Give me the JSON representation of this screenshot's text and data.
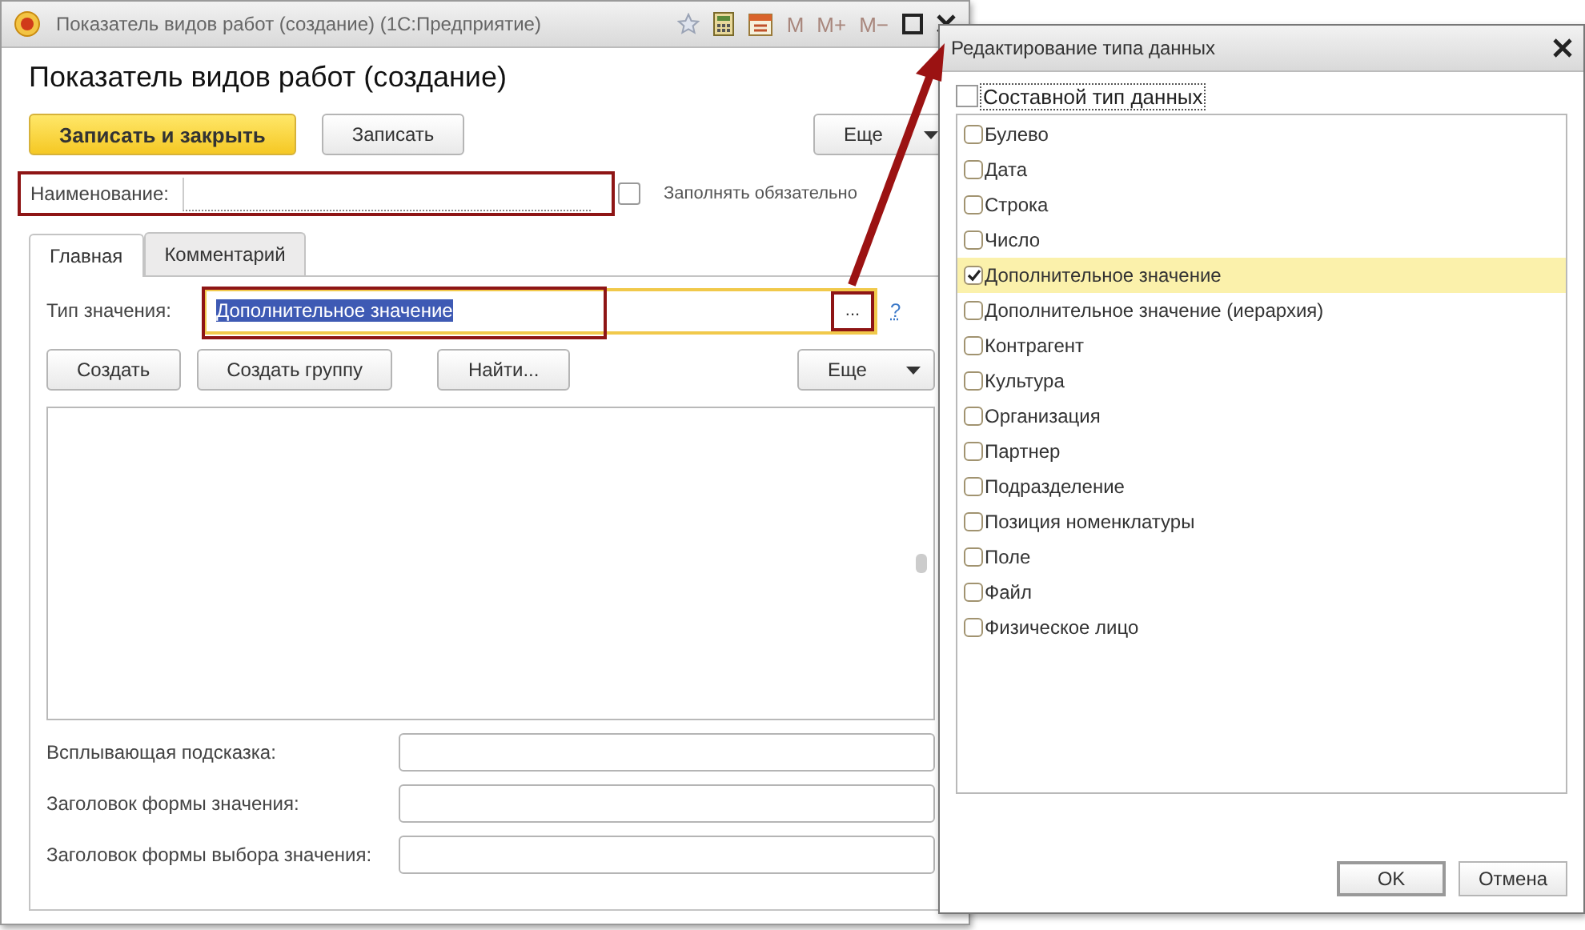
{
  "main_window": {
    "title": "Показатель видов работ (создание)  (1С:Предприятие)",
    "memory_buttons": [
      "M",
      "M+",
      "M−"
    ],
    "heading": "Показатель видов работ (создание)",
    "command_bar": [
      {
        "label": "Записать и закрыть",
        "kind": "primary"
      },
      {
        "label": "Записать",
        "kind": "plain"
      },
      {
        "label": "Еще",
        "kind": "menu"
      }
    ],
    "name_field": {
      "label": "Наименование:"
    },
    "required_checkbox": {
      "label": "Заполнять обязательно",
      "checked": false
    },
    "tabs": [
      {
        "label": "Главная",
        "selected": true
      },
      {
        "label": "Комментарий",
        "selected": false
      }
    ],
    "value_type": {
      "label": "Тип значения:",
      "value": "Дополнительное значение",
      "select_button": "...",
      "help": "?"
    },
    "list_bar": [
      {
        "label": "Создать",
        "kind": "plain"
      },
      {
        "label": "Создать группу",
        "kind": "plain"
      },
      {
        "label": "Найти...",
        "kind": "plain"
      },
      {
        "label": "Еще",
        "kind": "menu"
      }
    ],
    "fields": [
      {
        "label": "Всплывающая подсказка:"
      },
      {
        "label": "Заголовок формы значения:"
      },
      {
        "label": "Заголовок формы выбора значения:"
      }
    ]
  },
  "dialog": {
    "title": "Редактирование типа данных",
    "composite": {
      "label": "Составной тип данных",
      "checked": false
    },
    "types": [
      {
        "label": "Булево",
        "checked": false,
        "selected": false
      },
      {
        "label": "Дата",
        "checked": false,
        "selected": false
      },
      {
        "label": "Строка",
        "checked": false,
        "selected": false
      },
      {
        "label": "Число",
        "checked": false,
        "selected": false
      },
      {
        "label": "Дополнительное значение",
        "checked": true,
        "selected": true
      },
      {
        "label": "Дополнительное значение (иерархия)",
        "checked": false,
        "selected": false
      },
      {
        "label": "Контрагент",
        "checked": false,
        "selected": false
      },
      {
        "label": "Культура",
        "checked": false,
        "selected": false
      },
      {
        "label": "Организация",
        "checked": false,
        "selected": false
      },
      {
        "label": "Партнер",
        "checked": false,
        "selected": false
      },
      {
        "label": "Подразделение",
        "checked": false,
        "selected": false
      },
      {
        "label": "Позиция номенклатуры",
        "checked": false,
        "selected": false
      },
      {
        "label": "Поле",
        "checked": false,
        "selected": false
      },
      {
        "label": "Файл",
        "checked": false,
        "selected": false
      },
      {
        "label": "Физическое лицо",
        "checked": false,
        "selected": false
      }
    ],
    "buttons": [
      "OK",
      "Отмена"
    ]
  }
}
